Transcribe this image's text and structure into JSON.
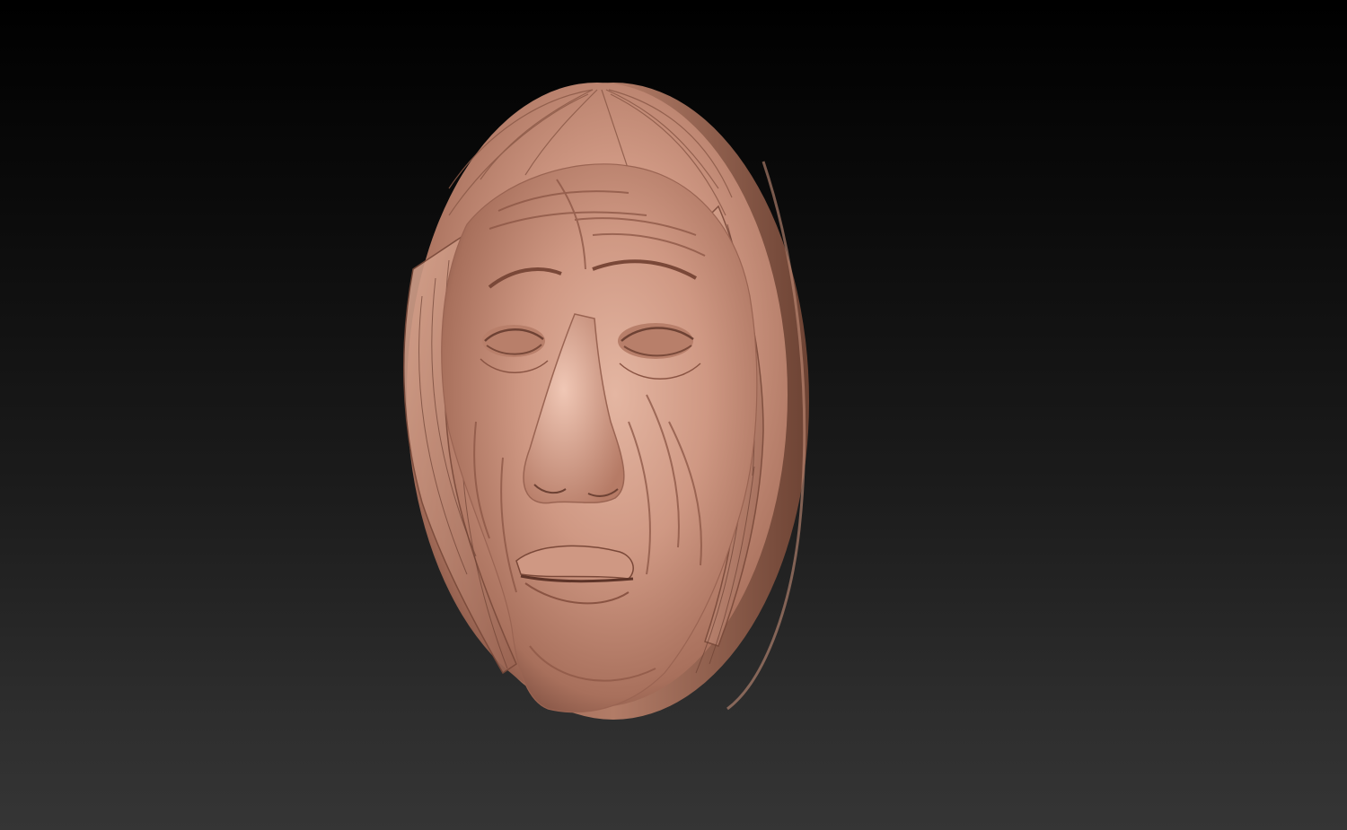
{
  "scene": {
    "subject": "relief-medallion-sculpt",
    "material_color": "#c58b73",
    "material_highlight": "#e2b19c",
    "material_shadow": "#6e4234",
    "background_top": "#000000",
    "background_bottom": "#353535"
  }
}
